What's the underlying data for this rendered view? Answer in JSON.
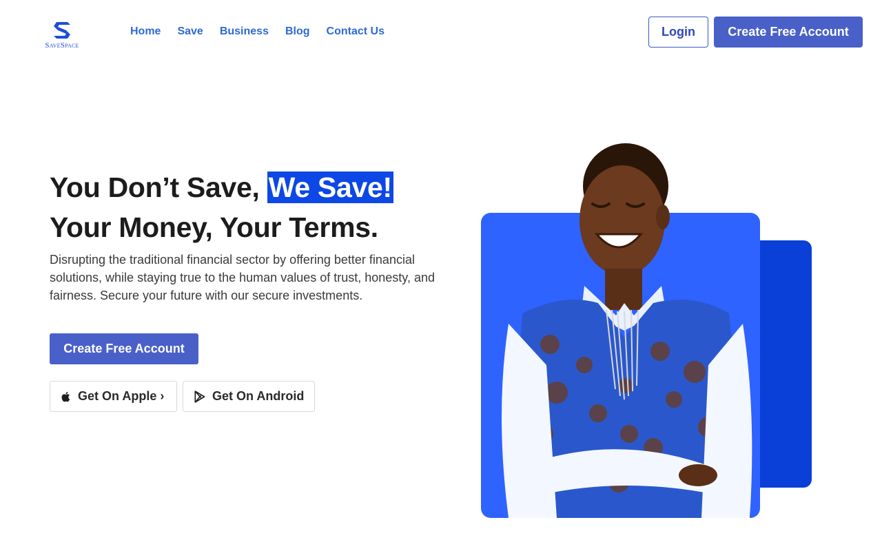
{
  "header": {
    "logo_text": "SaveSpace",
    "nav": [
      "Home",
      "Save",
      "Business",
      "Blog",
      "Contact Us"
    ],
    "login_label": "Login",
    "create_account_label": "Create Free Account"
  },
  "hero": {
    "headline_part1": "You Don’t Save, ",
    "headline_highlight": "We Save!",
    "headline_line2": "Your Money, Your Terms.",
    "description": "Disrupting the traditional financial sector by offering better financial solutions, while staying true to the human values of trust, honesty, and fairness. Secure your future with our secure investments.",
    "cta_label": "Create Free Account",
    "apple_label": "Get On Apple ›",
    "android_label": "Get On Android"
  },
  "colors": {
    "brand": "#4960c9",
    "nav_link": "#2e6ad3",
    "highlight": "#0d47e6",
    "panel_front": "#2f63ff",
    "panel_back": "#0a3fd8"
  },
  "icons": {
    "logo": "s-logo-icon",
    "apple": "apple-icon",
    "android": "google-play-icon"
  }
}
